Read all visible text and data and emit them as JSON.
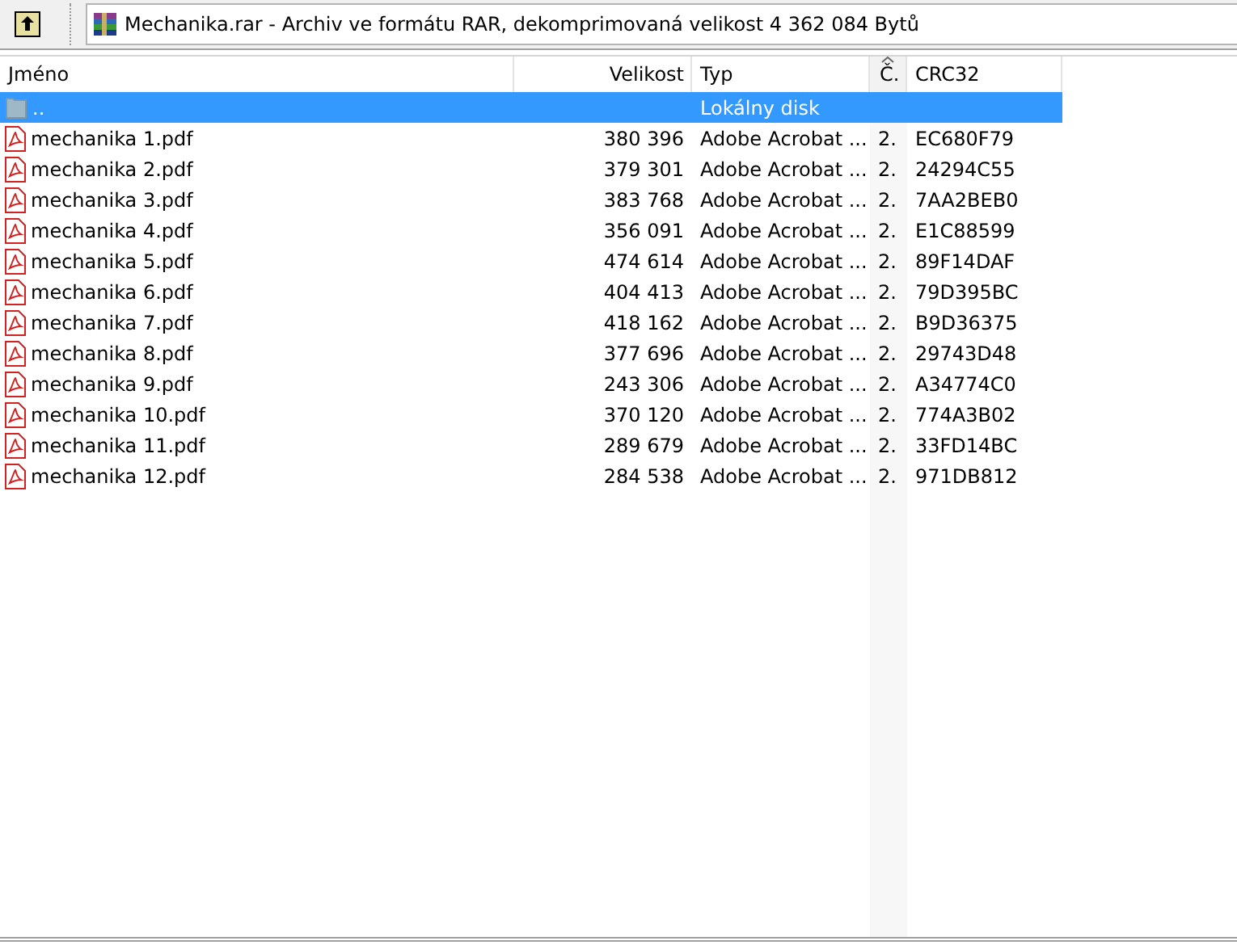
{
  "toolbar": {
    "path": "Mechanika.rar - Archiv ve formátu RAR, dekomprimovaná velikost 4 362 084 Bytů"
  },
  "table": {
    "columns": [
      {
        "label": "Jméno",
        "sorted": false
      },
      {
        "label": "Velikost",
        "sorted": false
      },
      {
        "label": "Typ",
        "sorted": false
      },
      {
        "label": "Č.",
        "sorted": true
      },
      {
        "label": "CRC32",
        "sorted": false
      }
    ],
    "rows": [
      {
        "kind": "folder",
        "selected": true,
        "name": "..",
        "size": "",
        "type": "Lokálny disk",
        "column_4": "",
        "crc": ""
      },
      {
        "kind": "pdf",
        "selected": false,
        "name": "mechanika 1.pdf",
        "size": "380 396",
        "type": "Adobe Acrobat ...",
        "column_4": "2.",
        "crc": "EC680F79"
      },
      {
        "kind": "pdf",
        "selected": false,
        "name": "mechanika 2.pdf",
        "size": "379 301",
        "type": "Adobe Acrobat ...",
        "column_4": "2.",
        "crc": "24294C55"
      },
      {
        "kind": "pdf",
        "selected": false,
        "name": "mechanika 3.pdf",
        "size": "383 768",
        "type": "Adobe Acrobat ...",
        "column_4": "2.",
        "crc": "7AA2BEB0"
      },
      {
        "kind": "pdf",
        "selected": false,
        "name": "mechanika 4.pdf",
        "size": "356 091",
        "type": "Adobe Acrobat ...",
        "column_4": "2.",
        "crc": "E1C88599"
      },
      {
        "kind": "pdf",
        "selected": false,
        "name": "mechanika 5.pdf",
        "size": "474 614",
        "type": "Adobe Acrobat ...",
        "column_4": "2.",
        "crc": "89F14DAF"
      },
      {
        "kind": "pdf",
        "selected": false,
        "name": "mechanika 6.pdf",
        "size": "404 413",
        "type": "Adobe Acrobat ...",
        "column_4": "2.",
        "crc": "79D395BC"
      },
      {
        "kind": "pdf",
        "selected": false,
        "name": "mechanika 7.pdf",
        "size": "418 162",
        "type": "Adobe Acrobat ...",
        "column_4": "2.",
        "crc": "B9D36375"
      },
      {
        "kind": "pdf",
        "selected": false,
        "name": "mechanika 8.pdf",
        "size": "377 696",
        "type": "Adobe Acrobat ...",
        "column_4": "2.",
        "crc": "29743D48"
      },
      {
        "kind": "pdf",
        "selected": false,
        "name": "mechanika 9.pdf",
        "size": "243 306",
        "type": "Adobe Acrobat ...",
        "column_4": "2.",
        "crc": "A34774C0"
      },
      {
        "kind": "pdf",
        "selected": false,
        "name": "mechanika 10.pdf",
        "size": "370 120",
        "type": "Adobe Acrobat ...",
        "column_4": "2.",
        "crc": "774A3B02"
      },
      {
        "kind": "pdf",
        "selected": false,
        "name": "mechanika 11.pdf",
        "size": "289 679",
        "type": "Adobe Acrobat ...",
        "column_4": "2.",
        "crc": "33FD14BC"
      },
      {
        "kind": "pdf",
        "selected": false,
        "name": "mechanika 12.pdf",
        "size": "284 538",
        "type": "Adobe Acrobat ...",
        "column_4": "2.",
        "crc": "971DB812"
      }
    ]
  }
}
